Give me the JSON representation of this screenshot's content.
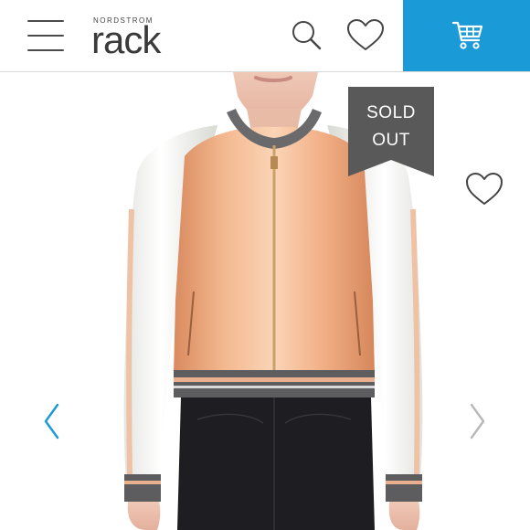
{
  "header": {
    "logo_small": "NORDSTROM",
    "logo_big": "rack",
    "icons": [
      "menu-icon",
      "search-icon",
      "heart-icon",
      "cart-icon"
    ],
    "cart_bg_color": "#1a9ad6"
  },
  "product": {
    "badge_line1": "SOLD",
    "badge_line2": "OUT",
    "badge_color": "#595959",
    "icons": [
      "heart-icon",
      "chevron-left-icon",
      "chevron-right-icon"
    ]
  }
}
